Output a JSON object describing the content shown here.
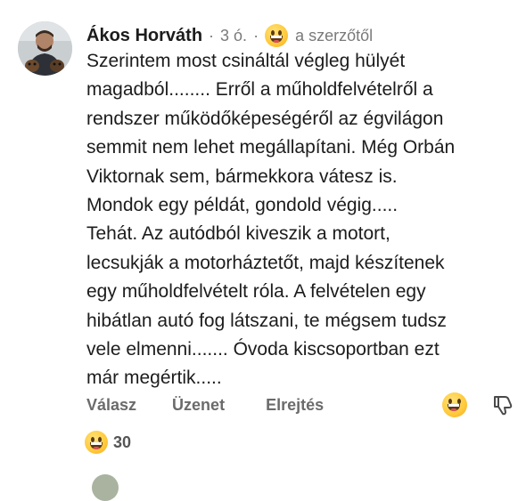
{
  "comment": {
    "author": "Ákos Horváth",
    "time": "3 ó.",
    "separator": "·",
    "author_badge": "a szerzőtől",
    "text": "Szerintem most csináltál végleg hülyét\nmagadból........ Erről a műholdfelvételről a\nrendszer működőképeségéről az égvilágon\nsemmit nem lehet megállapítani. Még Orbán\nViktornak sem, bármekkora vátesz is.\nMondok egy példát, gondold végig.....\nTehát. Az autódból kiveszik a motort,\nlecsukják a motorháztetőt, majd készítenek\negy műholdfelvételt róla. A felvételen egy\nhibátlan autó fog látszani, te mégsem tudsz\nvele elmenni....... Óvoda kiscsoportban ezt\nmár megértik.....",
    "avatar_icon": "avatar-photo"
  },
  "actions": {
    "reply": "Válasz",
    "message": "Üzenet",
    "hide": "Elrejtés",
    "react_icon": "grinning-face-icon",
    "dislike_icon": "thumbs-down-icon"
  },
  "reactions": {
    "icon": "grinning-face-icon",
    "count": "30"
  },
  "colors": {
    "text": "#1c1c1c",
    "meta": "#7a7a7a",
    "action": "#6b6b6b",
    "emoji": "#ffc93a"
  }
}
